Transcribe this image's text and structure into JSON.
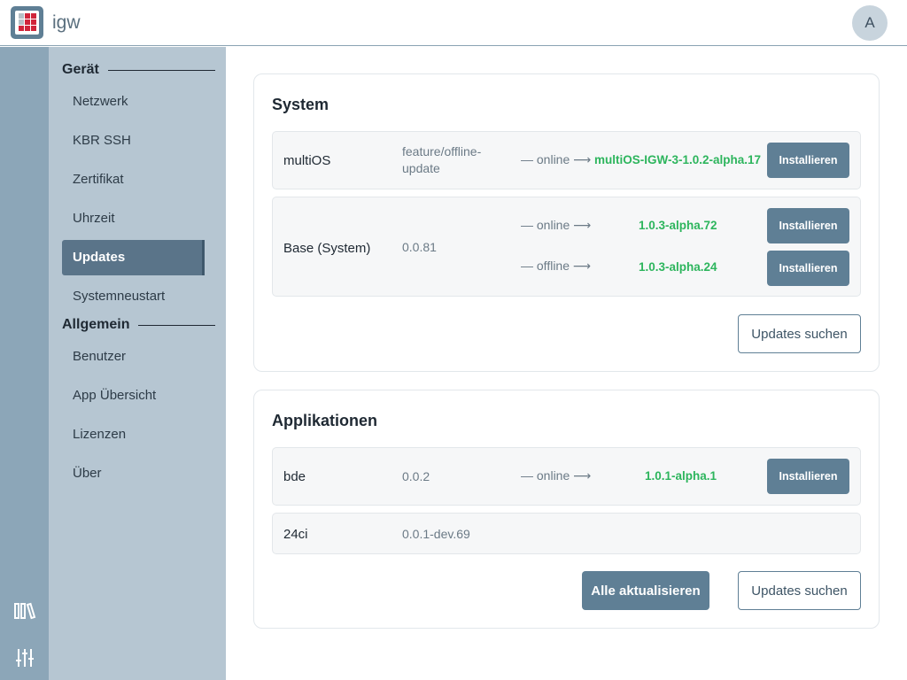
{
  "header": {
    "app_name": "igw",
    "avatar_initial": "A"
  },
  "rail": {
    "icons": [
      "library-icon",
      "sliders-icon"
    ]
  },
  "nav": {
    "section_device": "Gerät",
    "device_items": [
      "Netzwerk",
      "KBR SSH",
      "Zertifikat",
      "Uhrzeit",
      "Updates",
      "Systemneustart"
    ],
    "section_general": "Allgemein",
    "general_items": [
      "Benutzer",
      "App Übersicht",
      "Lizenzen",
      "Über"
    ],
    "active": "Updates"
  },
  "system": {
    "title": "System",
    "multios": {
      "name": "multiOS",
      "version": "feature/offline-update",
      "channel": "online",
      "target": "multiOS-IGW-3-1.0.2-alpha.17",
      "button": "Installieren"
    },
    "base": {
      "name": "Base (System)",
      "version": "0.0.81",
      "online_channel": "online",
      "online_target": "1.0.3-alpha.72",
      "online_button": "Installieren",
      "offline_channel": "offline",
      "offline_target": "1.0.3-alpha.24",
      "offline_button": "Installieren"
    },
    "check_button": "Updates suchen"
  },
  "apps": {
    "title": "Applikationen",
    "bde": {
      "name": "bde",
      "version": "0.0.2",
      "channel": "online",
      "target": "1.0.1-alpha.1",
      "button": "Installieren"
    },
    "ci": {
      "name": "24ci",
      "version": "0.0.1-dev.69"
    },
    "update_all_button": "Alle aktualisieren",
    "check_button": "Updates suchen"
  },
  "colors": {
    "accent": "#5f7f95",
    "success": "#2db55d",
    "rail": "#8ca6b8",
    "nav": "#b6c6d2"
  }
}
